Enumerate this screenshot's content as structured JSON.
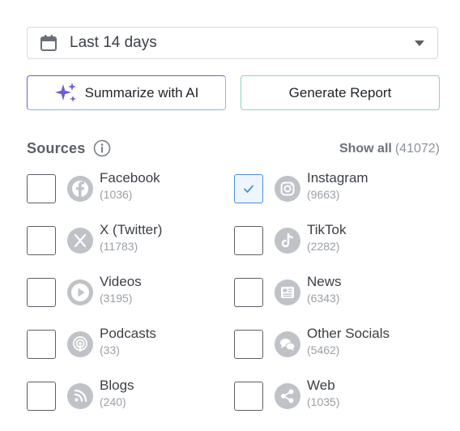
{
  "date_range": {
    "label": "Last 14 days",
    "icon": "calendar-icon"
  },
  "actions": {
    "summarize_label": "Summarize with AI",
    "report_label": "Generate Report"
  },
  "sources": {
    "title": "Sources",
    "show_all_label": "Show all",
    "show_all_count": "(41072)",
    "items": [
      {
        "name": "Facebook",
        "count": "(1036)",
        "checked": false,
        "icon": "facebook-icon"
      },
      {
        "name": "Instagram",
        "count": "(9663)",
        "checked": true,
        "icon": "instagram-icon"
      },
      {
        "name": "X (Twitter)",
        "count": "(11783)",
        "checked": false,
        "icon": "x-twitter-icon"
      },
      {
        "name": "TikTok",
        "count": "(2282)",
        "checked": false,
        "icon": "tiktok-icon"
      },
      {
        "name": "Videos",
        "count": "(3195)",
        "checked": false,
        "icon": "play-icon"
      },
      {
        "name": "News",
        "count": "(6343)",
        "checked": false,
        "icon": "newspaper-icon"
      },
      {
        "name": "Podcasts",
        "count": "(33)",
        "checked": false,
        "icon": "podcast-icon"
      },
      {
        "name": "Other Socials",
        "count": "(5462)",
        "checked": false,
        "icon": "chat-bubbles-icon"
      },
      {
        "name": "Blogs",
        "count": "(240)",
        "checked": false,
        "icon": "rss-icon"
      },
      {
        "name": "Web",
        "count": "(1035)",
        "checked": false,
        "icon": "share-icon"
      }
    ]
  },
  "colors": {
    "accent_purple": "#6b5fd3",
    "accent_teal": "#8fd0c6",
    "check_blue": "#4b8fd6",
    "icon_gray": "#bfc3c8"
  }
}
